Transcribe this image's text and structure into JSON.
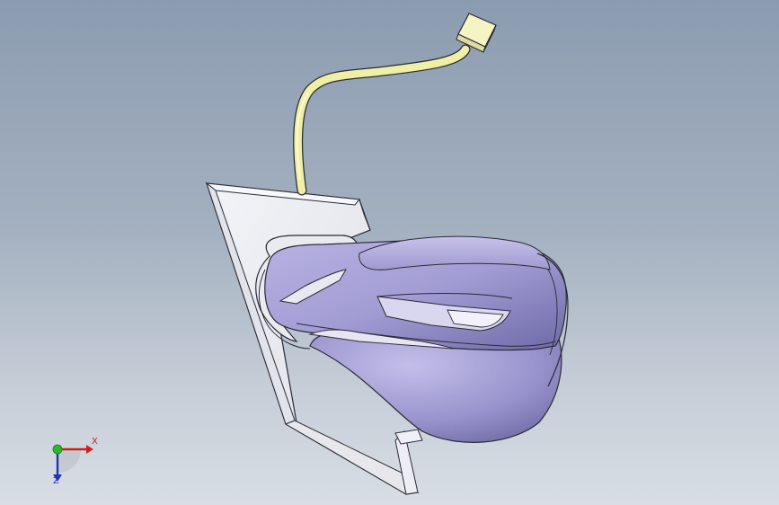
{
  "viewport": {
    "background_top": "#8c9cb0",
    "background_bottom": "#d9dee5"
  },
  "model": {
    "body_color": "#9d97cf",
    "bracket_color": "#eef0f5",
    "cable_color": "#f0efa6",
    "edge_color": "#2b2b33"
  },
  "triad": {
    "x_label": "X",
    "z_label": "Z",
    "x_color": "#d21e1e",
    "y_color": "#2fb52f",
    "z_color": "#2233bb"
  }
}
